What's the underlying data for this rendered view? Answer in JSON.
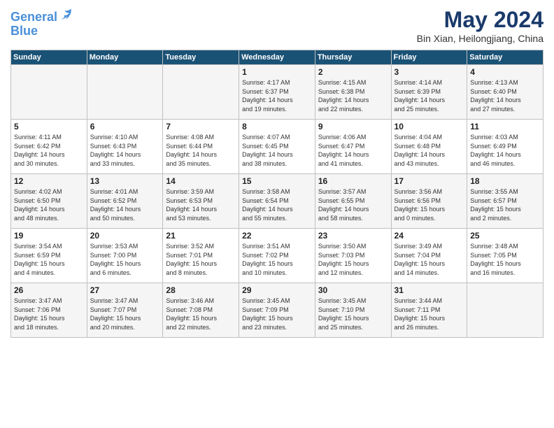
{
  "header": {
    "logo_line1": "General",
    "logo_line2": "Blue",
    "month_year": "May 2024",
    "location": "Bin Xian, Heilongjiang, China"
  },
  "days_of_week": [
    "Sunday",
    "Monday",
    "Tuesday",
    "Wednesday",
    "Thursday",
    "Friday",
    "Saturday"
  ],
  "weeks": [
    [
      {
        "num": "",
        "content": ""
      },
      {
        "num": "",
        "content": ""
      },
      {
        "num": "",
        "content": ""
      },
      {
        "num": "1",
        "content": "Sunrise: 4:17 AM\nSunset: 6:37 PM\nDaylight: 14 hours\nand 19 minutes."
      },
      {
        "num": "2",
        "content": "Sunrise: 4:15 AM\nSunset: 6:38 PM\nDaylight: 14 hours\nand 22 minutes."
      },
      {
        "num": "3",
        "content": "Sunrise: 4:14 AM\nSunset: 6:39 PM\nDaylight: 14 hours\nand 25 minutes."
      },
      {
        "num": "4",
        "content": "Sunrise: 4:13 AM\nSunset: 6:40 PM\nDaylight: 14 hours\nand 27 minutes."
      }
    ],
    [
      {
        "num": "5",
        "content": "Sunrise: 4:11 AM\nSunset: 6:42 PM\nDaylight: 14 hours\nand 30 minutes."
      },
      {
        "num": "6",
        "content": "Sunrise: 4:10 AM\nSunset: 6:43 PM\nDaylight: 14 hours\nand 33 minutes."
      },
      {
        "num": "7",
        "content": "Sunrise: 4:08 AM\nSunset: 6:44 PM\nDaylight: 14 hours\nand 35 minutes."
      },
      {
        "num": "8",
        "content": "Sunrise: 4:07 AM\nSunset: 6:45 PM\nDaylight: 14 hours\nand 38 minutes."
      },
      {
        "num": "9",
        "content": "Sunrise: 4:06 AM\nSunset: 6:47 PM\nDaylight: 14 hours\nand 41 minutes."
      },
      {
        "num": "10",
        "content": "Sunrise: 4:04 AM\nSunset: 6:48 PM\nDaylight: 14 hours\nand 43 minutes."
      },
      {
        "num": "11",
        "content": "Sunrise: 4:03 AM\nSunset: 6:49 PM\nDaylight: 14 hours\nand 46 minutes."
      }
    ],
    [
      {
        "num": "12",
        "content": "Sunrise: 4:02 AM\nSunset: 6:50 PM\nDaylight: 14 hours\nand 48 minutes."
      },
      {
        "num": "13",
        "content": "Sunrise: 4:01 AM\nSunset: 6:52 PM\nDaylight: 14 hours\nand 50 minutes."
      },
      {
        "num": "14",
        "content": "Sunrise: 3:59 AM\nSunset: 6:53 PM\nDaylight: 14 hours\nand 53 minutes."
      },
      {
        "num": "15",
        "content": "Sunrise: 3:58 AM\nSunset: 6:54 PM\nDaylight: 14 hours\nand 55 minutes."
      },
      {
        "num": "16",
        "content": "Sunrise: 3:57 AM\nSunset: 6:55 PM\nDaylight: 14 hours\nand 58 minutes."
      },
      {
        "num": "17",
        "content": "Sunrise: 3:56 AM\nSunset: 6:56 PM\nDaylight: 15 hours\nand 0 minutes."
      },
      {
        "num": "18",
        "content": "Sunrise: 3:55 AM\nSunset: 6:57 PM\nDaylight: 15 hours\nand 2 minutes."
      }
    ],
    [
      {
        "num": "19",
        "content": "Sunrise: 3:54 AM\nSunset: 6:59 PM\nDaylight: 15 hours\nand 4 minutes."
      },
      {
        "num": "20",
        "content": "Sunrise: 3:53 AM\nSunset: 7:00 PM\nDaylight: 15 hours\nand 6 minutes."
      },
      {
        "num": "21",
        "content": "Sunrise: 3:52 AM\nSunset: 7:01 PM\nDaylight: 15 hours\nand 8 minutes."
      },
      {
        "num": "22",
        "content": "Sunrise: 3:51 AM\nSunset: 7:02 PM\nDaylight: 15 hours\nand 10 minutes."
      },
      {
        "num": "23",
        "content": "Sunrise: 3:50 AM\nSunset: 7:03 PM\nDaylight: 15 hours\nand 12 minutes."
      },
      {
        "num": "24",
        "content": "Sunrise: 3:49 AM\nSunset: 7:04 PM\nDaylight: 15 hours\nand 14 minutes."
      },
      {
        "num": "25",
        "content": "Sunrise: 3:48 AM\nSunset: 7:05 PM\nDaylight: 15 hours\nand 16 minutes."
      }
    ],
    [
      {
        "num": "26",
        "content": "Sunrise: 3:47 AM\nSunset: 7:06 PM\nDaylight: 15 hours\nand 18 minutes."
      },
      {
        "num": "27",
        "content": "Sunrise: 3:47 AM\nSunset: 7:07 PM\nDaylight: 15 hours\nand 20 minutes."
      },
      {
        "num": "28",
        "content": "Sunrise: 3:46 AM\nSunset: 7:08 PM\nDaylight: 15 hours\nand 22 minutes."
      },
      {
        "num": "29",
        "content": "Sunrise: 3:45 AM\nSunset: 7:09 PM\nDaylight: 15 hours\nand 23 minutes."
      },
      {
        "num": "30",
        "content": "Sunrise: 3:45 AM\nSunset: 7:10 PM\nDaylight: 15 hours\nand 25 minutes."
      },
      {
        "num": "31",
        "content": "Sunrise: 3:44 AM\nSunset: 7:11 PM\nDaylight: 15 hours\nand 26 minutes."
      },
      {
        "num": "",
        "content": ""
      }
    ]
  ]
}
